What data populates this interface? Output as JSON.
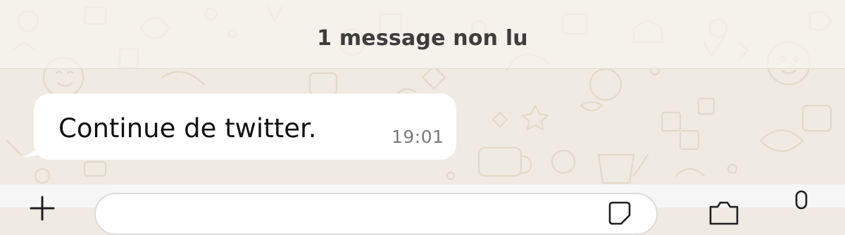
{
  "chat": {
    "unread_banner": "1 message non lu",
    "messages": [
      {
        "text": "Continue de twitter.",
        "time": "19:01",
        "direction": "incoming"
      }
    ]
  },
  "composer": {
    "input_value": "",
    "icons": [
      "plus-icon",
      "sticker-icon",
      "camera-icon",
      "microphone-icon"
    ]
  },
  "colors": {
    "wallpaper": "#efeae2",
    "bubble_incoming": "#ffffff",
    "banner_text": "#3d3d3d",
    "timestamp": "#7a7a7a"
  }
}
